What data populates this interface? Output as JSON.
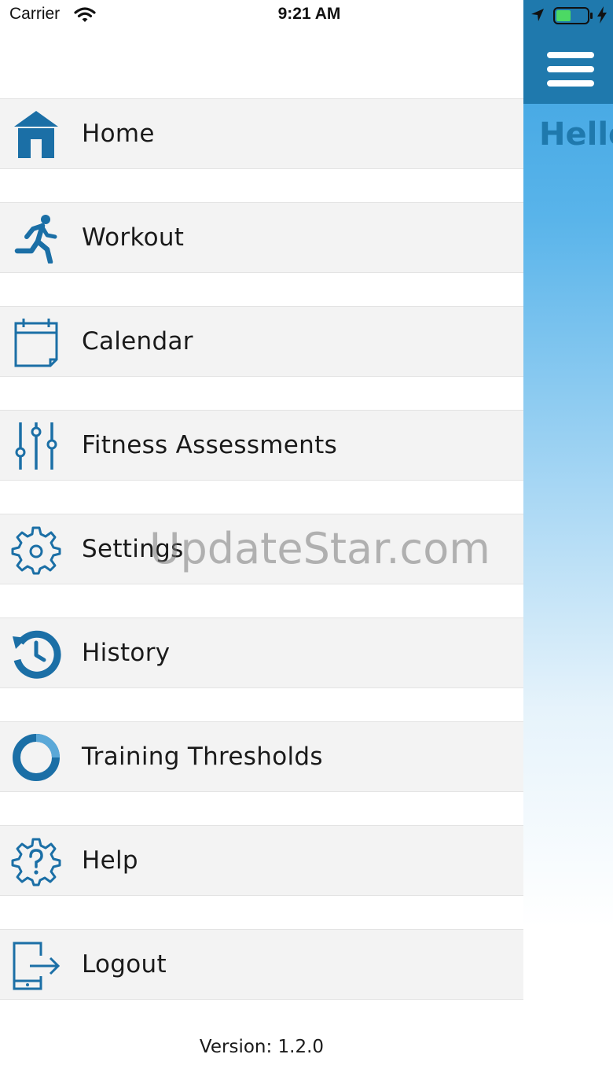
{
  "status_bar": {
    "carrier": "Carrier",
    "time": "9:21 AM",
    "battery_color": "#4cd964"
  },
  "menu": {
    "items": [
      {
        "label": "Home",
        "icon": "home-icon"
      },
      {
        "label": "Workout",
        "icon": "runner-icon"
      },
      {
        "label": "Calendar",
        "icon": "calendar-icon"
      },
      {
        "label": "Fitness Assessments",
        "icon": "sliders-icon"
      },
      {
        "label": "Settings",
        "icon": "gear-icon"
      },
      {
        "label": "History",
        "icon": "history-icon"
      },
      {
        "label": "Training Thresholds",
        "icon": "ring-icon"
      },
      {
        "label": "Help",
        "icon": "help-gear-icon"
      },
      {
        "label": "Logout",
        "icon": "logout-icon"
      }
    ],
    "icon_color": "#1b6fa6",
    "version": "Version: 1.2.0"
  },
  "main": {
    "greeting": "Hello",
    "header_color": "#1f79ad"
  },
  "watermark": "UpdateStar.com"
}
